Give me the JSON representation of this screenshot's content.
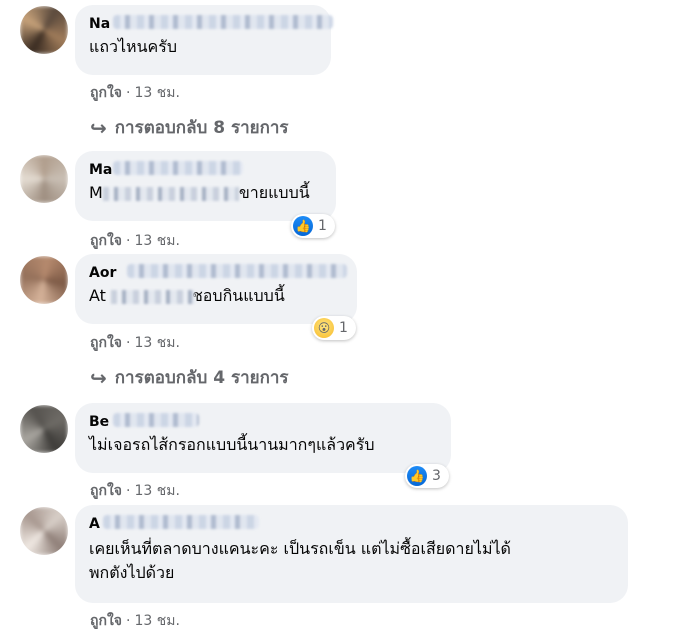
{
  "colors": {
    "bubble": "#f0f2f5",
    "meta_text": "#65676b",
    "like_blue": "#1877f2"
  },
  "comments": [
    {
      "name": "Na",
      "text": "แถวไหนครับ",
      "like_label": "ถูกใจ",
      "time": "13 ชม.",
      "replies": "การตอบกลับ 8 รายการ"
    },
    {
      "name": "Ma",
      "text_prefix": "M",
      "text": "ขายแบบนี้",
      "like_label": "ถูกใจ",
      "time": "13 ชม.",
      "reaction": {
        "icon": "like-icon",
        "count": "1"
      }
    },
    {
      "name": "Aor",
      "text_prefix": "At",
      "text": "ชอบกินแบบนี้",
      "like_label": "ถูกใจ",
      "time": "13 ชม.",
      "reaction": {
        "icon": "wow-icon",
        "count": "1"
      },
      "replies": "การตอบกลับ 4 รายการ"
    },
    {
      "name": "Be",
      "text": "ไม่เจอรถไส้กรอกแบบนี้นานมากๆแล้วครับ",
      "like_label": "ถูกใจ",
      "time": "13 ชม.",
      "reaction": {
        "icon": "like-icon",
        "count": "3"
      }
    },
    {
      "name": "A",
      "text": "เคยเห็นที่ตลาดบางแคนะคะ เป็นรถเข็น แต่ไม่ซื้อเสียดายไม่ได้",
      "text_line2": "พกตังไปด้วย",
      "like_label": "ถูกใจ",
      "time": "13 ชม."
    }
  ]
}
